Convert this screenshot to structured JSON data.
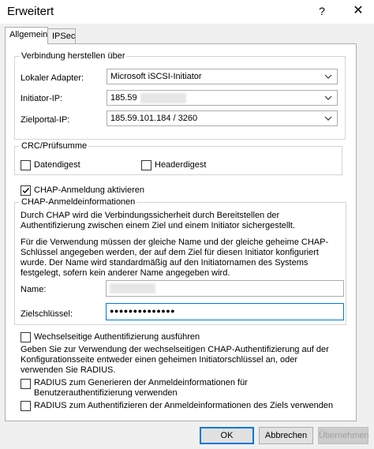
{
  "window": {
    "title": "Erweitert",
    "help_glyph": "?",
    "close_glyph": "✕"
  },
  "tabs": [
    {
      "label": "Allgemein",
      "active": true
    },
    {
      "label": "IPSec",
      "active": false
    }
  ],
  "connection": {
    "legend": "Verbindung herstellen über",
    "adapter": {
      "label": "Lokaler Adapter:",
      "value": "Microsoft iSCSI-Initiator"
    },
    "initiator_ip": {
      "label": "Initiator-IP:",
      "value": "185.59"
    },
    "target_portal_ip": {
      "label": "Zielportal-IP:",
      "value": "185.59.101.184 / 3260"
    }
  },
  "crc": {
    "legend": "CRC/Prüfsumme",
    "data_digest": {
      "label": "Datendigest",
      "checked": false
    },
    "header_digest": {
      "label": "Headerdigest",
      "checked": false
    }
  },
  "chap": {
    "enable": {
      "label": "CHAP-Anmeldung aktivieren",
      "checked": true
    },
    "legend": "CHAP-Anmeldeinformationen",
    "desc1": "Durch CHAP wird die Verbindungssicherheit durch Bereitstellen der Authentifizierung zwischen einem Ziel und einem Initiator sichergestellt.",
    "desc2": "Für die Verwendung müssen der gleiche Name und der gleiche geheime CHAP-Schlüssel angegeben werden, der auf dem Ziel für diesen Initiator konfiguriert wurde. Der Name wird standardmäßig auf den Initiatornamen des Systems festgelegt, sofern kein anderer Name angegeben wird.",
    "name_label": "Name:",
    "secret_label": "Zielschlüssel:",
    "secret_value": "●●●●●●●●●●●●●●"
  },
  "mutual": {
    "enable": {
      "label": "Wechselseitige Authentifizierung ausführen",
      "checked": false
    },
    "desc": "Geben Sie zur Verwendung der wechselseitigen CHAP-Authentifizierung auf der Konfigurationsseite entweder einen geheimen Initiatorschlüssel an, oder verwenden Sie RADIUS.",
    "radius_generate": {
      "label": "RADIUS zum Generieren der Anmeldeinformationen für Benutzerauthentifizierung verwenden",
      "checked": false
    },
    "radius_target": {
      "label": "RADIUS zum Authentifizieren der Anmeldeinformationen des Ziels verwenden",
      "checked": false
    }
  },
  "buttons": {
    "ok": "OK",
    "cancel": "Abbrechen",
    "apply": "Übernehmen"
  },
  "colors": {
    "focus_border": "#0078d7",
    "window_bg": "#f0f0f0"
  }
}
